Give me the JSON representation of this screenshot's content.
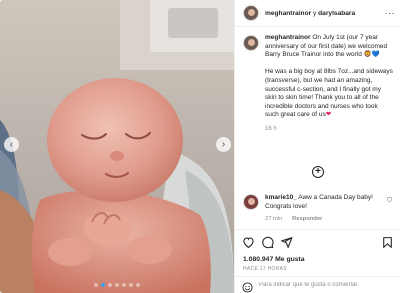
{
  "media": {
    "prev_icon": "chevron-left-icon",
    "next_icon": "chevron-right-icon",
    "carousel_count": 7,
    "carousel_active_index": 1
  },
  "header": {
    "username": "meghantrainor",
    "connector": " y ",
    "collaborator": "darylsabara",
    "more_icon": "more-icon",
    "more_glyph": "···"
  },
  "caption": {
    "username": "meghantrainor",
    "paragraph1": "On July 1st (our 7 year anniversary of our first date) we welcomed Barry Bruce Trainor into the world",
    "paragraph1_emoji": " 🦁💙",
    "paragraph2": "He was a big boy at 8lbs 7oz...and sideways (transverse), but we had an amazing, successful c-section, and I finally got my skin to skin time! Thank you to all of the incredible doctors and nurses who took such great care of us",
    "paragraph2_emoji": "❤",
    "time": "16 h"
  },
  "load_more": {
    "icon": "plus-circle-icon",
    "glyph": "+"
  },
  "comments": [
    {
      "username": "kmarie10_",
      "text": " Aww a Canada Day baby! Congrats love!",
      "time": "27 min",
      "reply_label": "Responder",
      "like_icon": "heart-outline-icon"
    }
  ],
  "actions": {
    "like_icon": "heart-outline-icon",
    "comment_icon": "comment-icon",
    "share_icon": "share-icon",
    "save_icon": "bookmark-icon"
  },
  "likes": "1.080.947 Me gusta",
  "date": "HACE 17 HORAS",
  "add_comment": {
    "emoji_icon": "emoji-smile-icon",
    "placeholder": "Para indicar que te gusta o comentar."
  }
}
